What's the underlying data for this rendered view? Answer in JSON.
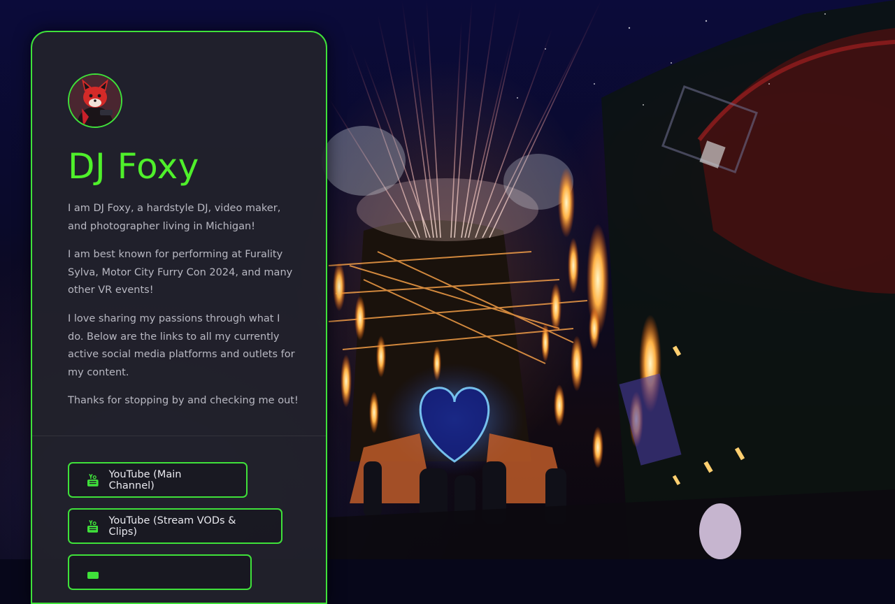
{
  "profile": {
    "name": "DJ Foxy",
    "avatar_icon": "fox-avatar",
    "bio": [
      "I am DJ Foxy, a hardstyle DJ, video maker, and photographer living in Michigan!",
      "I am best known for performing at Furality Sylva, Motor City Furry Con 2024, and many other VR events!",
      "I love sharing my passions through what I do. Below are the links to all my currently active social media platforms and outlets for my content.",
      "Thanks for stopping by and checking me out!"
    ]
  },
  "links": [
    {
      "label": "YouTube (Main Channel)",
      "icon": "youtube-icon"
    },
    {
      "label": "YouTube (Stream VODs & Clips)",
      "icon": "youtube-icon"
    },
    {
      "label": "",
      "icon": "youtube-icon"
    }
  ],
  "colors": {
    "accent": "#3fe13a",
    "title": "#4ff02b",
    "card_bg": "#22222c",
    "body_text": "#b8b8c2"
  }
}
